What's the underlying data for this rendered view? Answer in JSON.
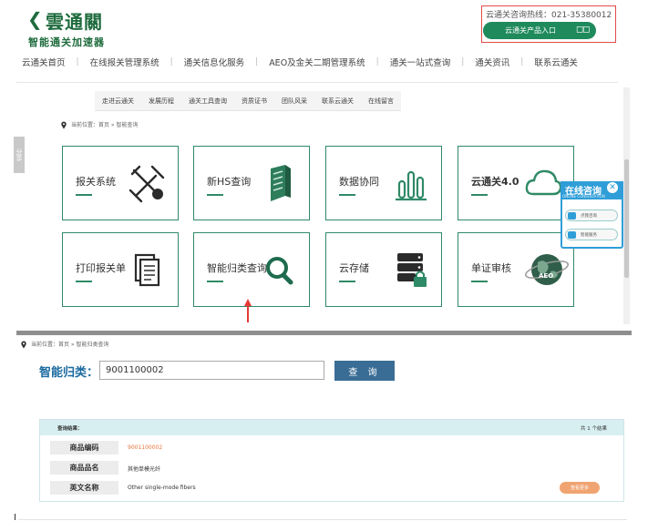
{
  "brand": {
    "name": "雲通關",
    "tagline": "智能通关加速器"
  },
  "hotline": {
    "text": "云通关咨询热线：021-35380012",
    "product_entry": "云通关产品入口",
    "grid_icon": "grid-icon"
  },
  "nav": [
    "云通关首页",
    "在线报关管理系统",
    "通关信息化服务",
    "AEO及金关二期管理系统",
    "通关一站式查询",
    "通关资讯",
    "联系云通关"
  ],
  "subnav": [
    "走进云通关",
    "发展历程",
    "通关工具查询",
    "资质证书",
    "团队风采",
    "联系云通关",
    "在线留言"
  ],
  "share_tab": "分享",
  "breadcrumb_top": "当前位置：首页 » 智能查询",
  "tiles": [
    {
      "label": "报关系统",
      "icon": "satellite-icon"
    },
    {
      "label": "新HS查询",
      "icon": "book-icon"
    },
    {
      "label": "数据协同",
      "icon": "bar-chart-icon"
    },
    {
      "label": "云通关4.0",
      "icon": "cloud-icon"
    },
    {
      "label": "打印报关单",
      "icon": "documents-icon"
    },
    {
      "label": "智能归类查询",
      "icon": "magnifier-icon"
    },
    {
      "label": "云存储",
      "icon": "server-lock-icon"
    },
    {
      "label": "单证审核",
      "icon": "aeo-globe-icon"
    }
  ],
  "consult": {
    "title": "在线咨询",
    "subtitle": "ONLINE CONSULTATION",
    "btn1": "点我咨询",
    "btn2": "智能服务"
  },
  "breadcrumb_bottom": "当前位置：首页 » 智能归类查询",
  "search": {
    "label": "智能归类：",
    "value": "9001100002",
    "button": "查 询"
  },
  "results": {
    "label": "查询结果：",
    "count_text": "共 1 个结果",
    "rows": [
      {
        "key": "商品编码",
        "value": "9001100002"
      },
      {
        "key": "商品品名",
        "value": "其他单模光纤"
      },
      {
        "key": "英文名称",
        "value": "Other single-mode fibers"
      }
    ],
    "more_button": "查看更多"
  },
  "colors": {
    "brand_green": "#1e6b3d",
    "tile_border": "#2f8a67",
    "annotation_red": "#e53935",
    "query_button": "#3a6d95",
    "code_orange": "#e8743a"
  }
}
